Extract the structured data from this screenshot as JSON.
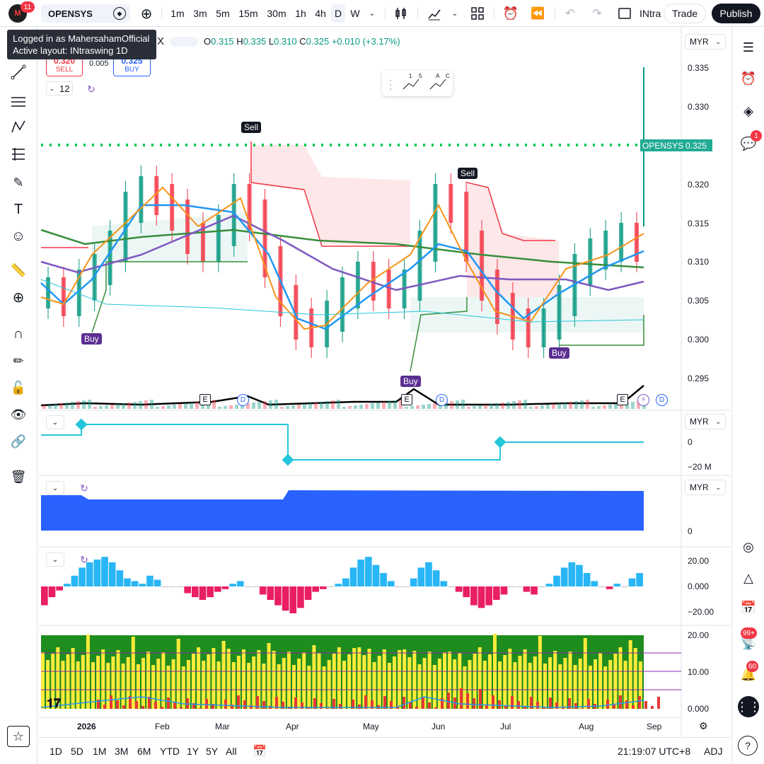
{
  "topbar": {
    "avatar_badge": "11",
    "symbol": "OPENSYS",
    "intervals": [
      "1m",
      "3m",
      "5m",
      "15m",
      "30m",
      "1h",
      "4h",
      "D",
      "W"
    ],
    "active_interval": "D",
    "layout_short": "INtra",
    "trade_label": "Trade",
    "publish_label": "Publish"
  },
  "tooltip": {
    "line1": "Logged in as MahersahamOfficial",
    "line2": "Active layout: INtraswing 1D"
  },
  "legend": {
    "o_label": "O",
    "o_val": "0.315",
    "h_label": "H",
    "h_val": "0.335",
    "l_label": "L",
    "l_val": "0.310",
    "c_label": "C",
    "c_val": "0.325",
    "change": "+0.010 (+3.17%)",
    "x_char": "X"
  },
  "order": {
    "sell_price": "0.320",
    "sell_label": "SELL",
    "spread": "0.005",
    "buy_price": "0.325",
    "buy_label": "BUY"
  },
  "interval_value": "12",
  "ticker_tag": {
    "name": "OPENSYS",
    "price": "0.325"
  },
  "scales": {
    "currency": "MYR",
    "main_prices": [
      "0.335",
      "0.330",
      "0.325",
      "0.320",
      "0.315",
      "0.310",
      "0.305",
      "0.300",
      "0.295"
    ],
    "pane1": [
      "0",
      "−20 M"
    ],
    "pane2": [
      "0"
    ],
    "pane3": [
      "20.00",
      "0.000",
      "−20.00"
    ],
    "pane4": [
      "20.00",
      "10.00",
      "0.000"
    ]
  },
  "signals": {
    "sell": "Sell",
    "buy": "Buy",
    "event_e": "E",
    "event_d": "D"
  },
  "time_axis": [
    "2026",
    "Feb",
    "Mar",
    "Apr",
    "May",
    "Jun",
    "Jul",
    "Aug",
    "Sep"
  ],
  "bottombar": {
    "ranges": [
      "1D",
      "5D",
      "1M",
      "3M",
      "6M",
      "YTD",
      "1Y",
      "5Y",
      "All"
    ],
    "clock": "21:19:07 UTC+8",
    "adj": "ADJ"
  },
  "rightbar": {
    "chat_badge": "1",
    "ideas_badge": "99+",
    "notif_badge": "60"
  },
  "colors": {
    "up": "#089981",
    "down": "#f23645",
    "accent": "#2962ff",
    "purple": "#7e57c2",
    "orange": "#f7931a",
    "green_line": "#388e3c",
    "cyan": "#26c6da"
  }
}
